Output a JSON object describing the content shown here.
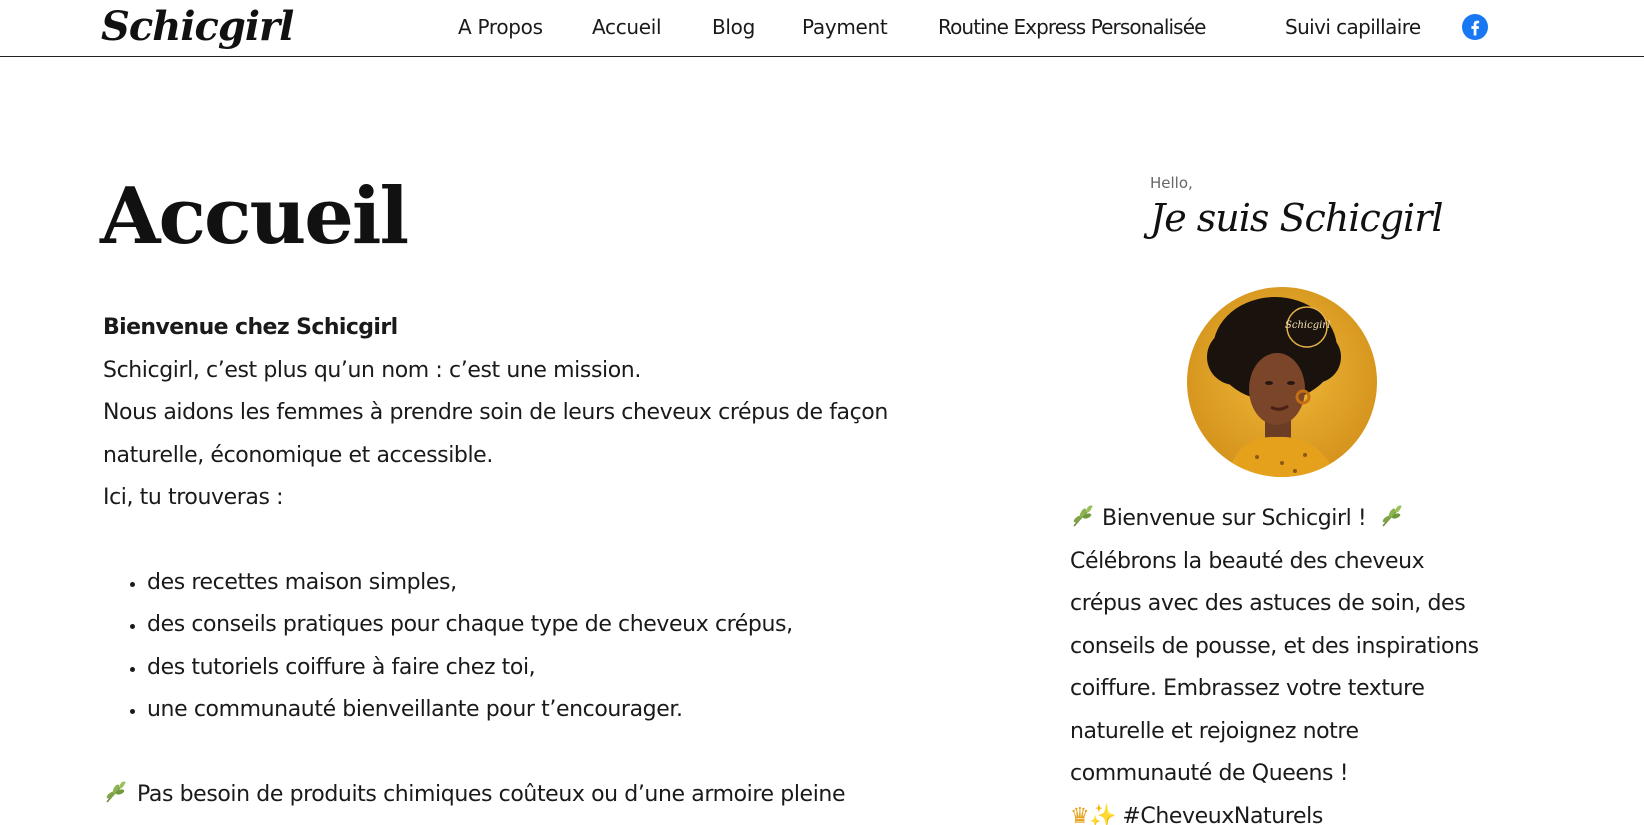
{
  "brand": {
    "logo": "Schicgirl"
  },
  "nav": {
    "items": [
      {
        "label": "A Propos"
      },
      {
        "label": "Accueil"
      },
      {
        "label": "Blog"
      },
      {
        "label": "Payment"
      },
      {
        "label": "Routine Express Personalisée"
      },
      {
        "label": "Suivi capillaire"
      }
    ],
    "social_icon": "facebook-icon",
    "social_color": "#1877F2"
  },
  "main": {
    "title": "Accueil",
    "lead": "Bienvenue chez Schicgirl",
    "paragraphs": [
      "Schicgirl, c’est plus qu’un nom : c’est une mission.",
      "Nous aidons les femmes à prendre soin de leurs cheveux crépus de façon naturelle, économique et accessible.",
      "Ici, tu trouveras :"
    ],
    "list": [
      "des recettes maison simples,",
      "des conseils pratiques pour chaque type de cheveux crépus,",
      "des tutoriels coiffure à faire chez toi,",
      "une communauté bienveillante pour t’encourager."
    ],
    "closing": "Pas besoin de produits chimiques coûteux ou d’une armoire pleine"
  },
  "sidebar": {
    "hello": "Hello,",
    "title": "Je suis Schicgirl",
    "avatar_badge": "Schicgirl",
    "avatar_bg": "#E0A21F",
    "welcome": "Bienvenue sur Schicgirl !",
    "body": "Célébrons la beauté des cheveux crépus avec des astuces de soin, des conseils de pousse, et des inspirations coiffure. Embrassez votre texture naturelle et rejoignez notre communauté de Queens !",
    "hashtag": "#CheveuxNaturels"
  }
}
